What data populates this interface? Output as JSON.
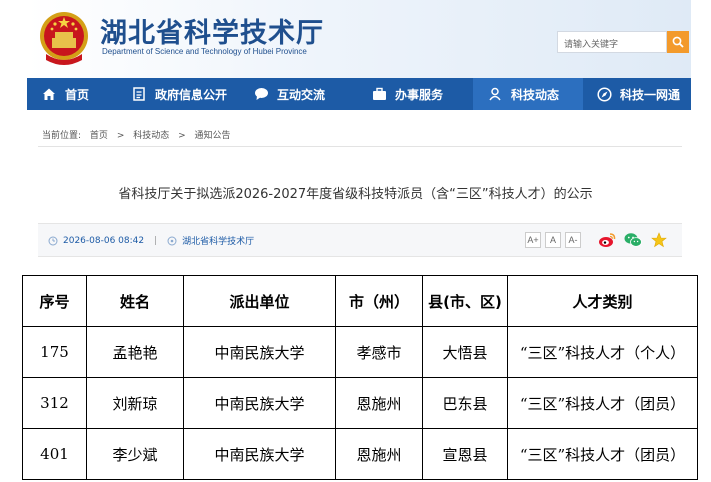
{
  "header": {
    "site_title": "湖北省科学技术厅",
    "site_subtitle": "Department of Science and Technology of Hubei Province",
    "search_placeholder": "请输入关键字"
  },
  "nav": {
    "items": [
      {
        "label": "首页",
        "icon": "home-icon"
      },
      {
        "label": "政府信息公开",
        "icon": "document-icon"
      },
      {
        "label": "互动交流",
        "icon": "chat-icon"
      },
      {
        "label": "办事服务",
        "icon": "briefcase-icon"
      },
      {
        "label": "科技动态",
        "icon": "person-icon"
      },
      {
        "label": "科技一网通",
        "icon": "compass-icon"
      }
    ],
    "active": "科技动态"
  },
  "breadcrumb": {
    "prefix": "当前位置:",
    "items": [
      "首页",
      ">",
      "科技动态",
      ">",
      "通知公告"
    ]
  },
  "article": {
    "title": "省科技厅关于拟选派2026-2027年度省级科技特派员（含“三区”科技人才）的公示",
    "datetime": "2026-08-06 08:42",
    "separator": "|",
    "source": "湖北省科学技术厅",
    "font_sizes": [
      "A+",
      "A",
      "A-"
    ]
  },
  "table": {
    "headers": [
      "序号",
      "姓名",
      "派出单位",
      "市（州）",
      "县(市、区)",
      "人才类别"
    ],
    "rows": [
      [
        "175",
        "孟艳艳",
        "中南民族大学",
        "孝感市",
        "大悟县",
        "“三区”科技人才（个人）"
      ],
      [
        "312",
        "刘新琼",
        "中南民族大学",
        "恩施州",
        "巴东县",
        "“三区”科技人才（团员）"
      ],
      [
        "401",
        "李少斌",
        "中南民族大学",
        "恩施州",
        "宣恩县",
        "“三区”科技人才（团员）"
      ]
    ]
  },
  "colors": {
    "nav_bg": "#1d5ba6",
    "brand_blue": "#1f4f8e",
    "search_button": "#f39a2b"
  }
}
